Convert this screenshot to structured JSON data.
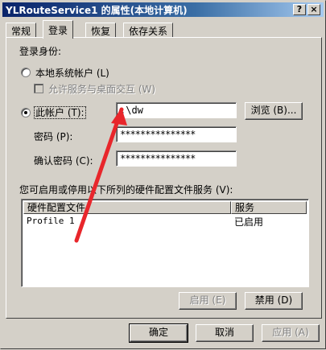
{
  "window": {
    "title": "YLRouteService1 的属性(本地计算机)",
    "help_button": "?",
    "close_button": "×"
  },
  "tabs": [
    {
      "label": "常规"
    },
    {
      "label": "登录",
      "active": true
    },
    {
      "label": "恢复"
    },
    {
      "label": "依存关系"
    }
  ],
  "logon": {
    "group_label": "登录身份:",
    "local_system_label": "本地系统帐户 (L)",
    "allow_desktop_label": "允许服务与桌面交互 (W)",
    "this_account_label": "此帐户 (T):",
    "account_value": ".\\dw",
    "browse_label": "浏览 (B)...",
    "password_label": "密码 (P):",
    "password_value": "***************",
    "confirm_label": "确认密码 (C):",
    "confirm_value": "***************"
  },
  "hardware": {
    "description": "您可启用或停用以下所列的硬件配置文件服务 (V):",
    "columns": [
      "硬件配置文件",
      "服务"
    ],
    "rows": [
      {
        "profile": "Profile 1",
        "service": "已启用"
      }
    ],
    "enable_label": "启用 (E)",
    "disable_label": "禁用 (D)"
  },
  "footer": {
    "ok_label": "确定",
    "cancel_label": "取消",
    "apply_label": "应用 (A)"
  },
  "colors": {
    "title_start": "#0a246a",
    "title_end": "#a6caf0",
    "annotation_arrow": "#e8262b",
    "face": "#d4d0c8"
  }
}
